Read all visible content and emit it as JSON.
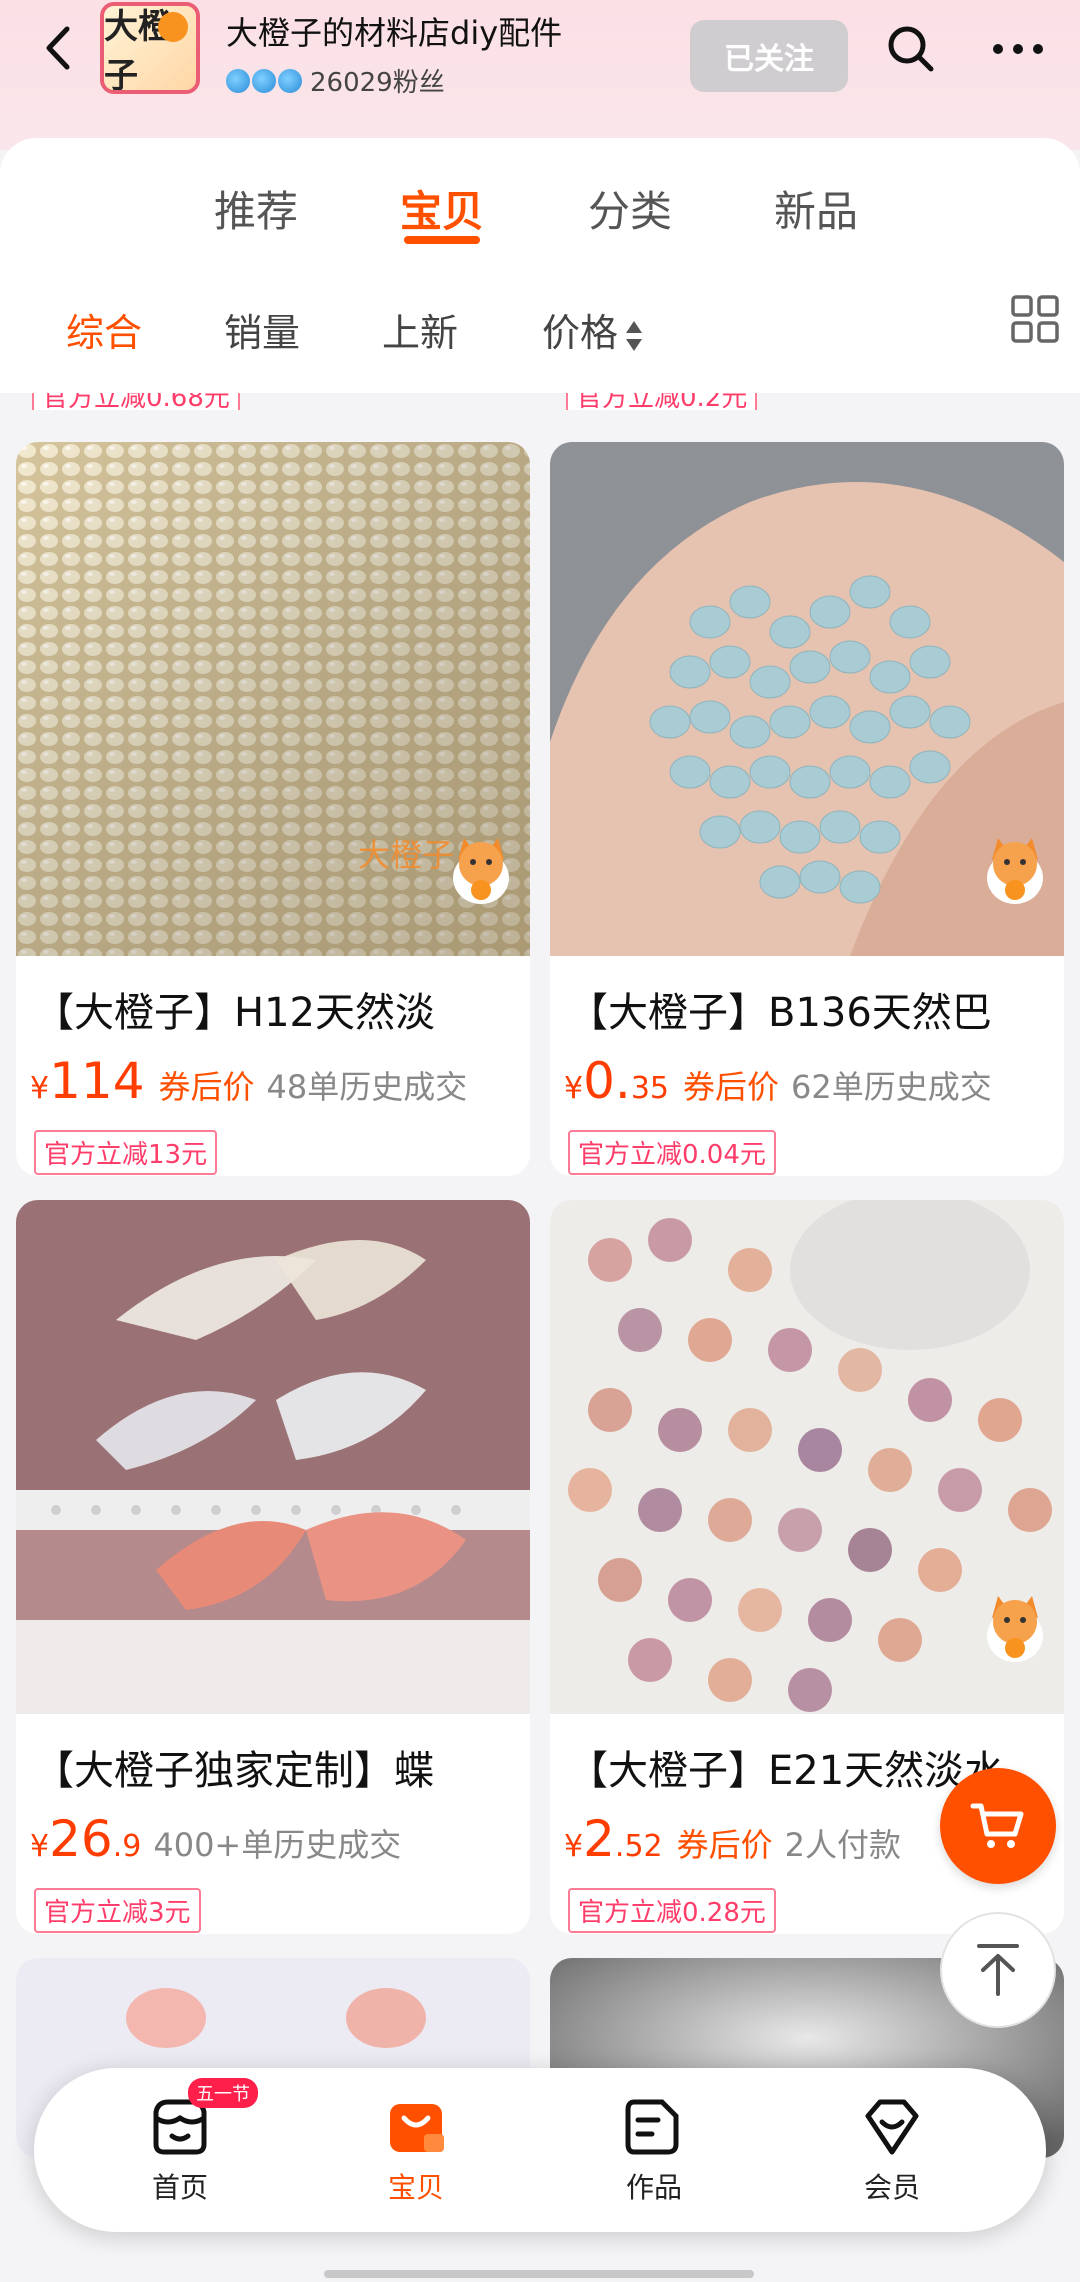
{
  "header": {
    "logo_text": "大橙子",
    "store_name": "大橙子的材料店diy配件",
    "fans": "26029粉丝",
    "follow_label": "已关注"
  },
  "tabs": [
    {
      "label": "推荐",
      "active": false
    },
    {
      "label": "宝贝",
      "active": true
    },
    {
      "label": "分类",
      "active": false
    },
    {
      "label": "新品",
      "active": false
    }
  ],
  "sorts": [
    {
      "label": "综合",
      "active": true
    },
    {
      "label": "销量",
      "active": false
    },
    {
      "label": "上新",
      "active": false
    },
    {
      "label": "价格",
      "active": false
    }
  ],
  "partial_badges": [
    "官方立减0.68元",
    "官方立减0.2元"
  ],
  "products": [
    {
      "title": "【大橙子】H12天然淡",
      "price_int": "114",
      "price_dec": "",
      "coupon": "券后价",
      "sold": "48单历史成交",
      "badge": "官方立减13元"
    },
    {
      "title": "【大橙子】B136天然巴",
      "price_int": "0.",
      "price_dec": "35",
      "coupon": "券后价",
      "sold": "62单历史成交",
      "badge": "官方立减0.04元"
    },
    {
      "title": "【大橙子独家定制】蝶",
      "price_int": "26",
      "price_dec": ".9",
      "coupon": "",
      "sold": "400+单历史成交",
      "badge": "官方立减3元"
    },
    {
      "title": "【大橙子】E21天然淡水",
      "price_int": "2",
      "price_dec": ".52",
      "coupon": "券后价",
      "sold": "2人付款",
      "badge": "官方立减0.28元"
    }
  ],
  "currency": "¥",
  "watermark": "大橙子",
  "bottom_nav": [
    {
      "label": "首页",
      "icon": "store-icon",
      "badge": "五一节"
    },
    {
      "label": "宝贝",
      "icon": "shopping-bag-icon",
      "active": true
    },
    {
      "label": "作品",
      "icon": "works-icon"
    },
    {
      "label": "会员",
      "icon": "member-icon"
    }
  ],
  "colors": {
    "accent": "#ff5000",
    "price": "#ff3d00",
    "badge": "#ff3d6a"
  }
}
